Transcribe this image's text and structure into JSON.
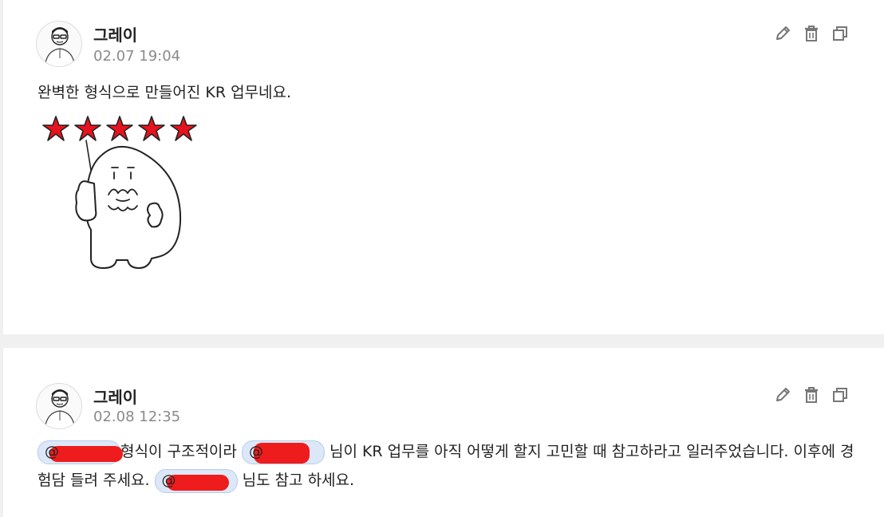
{
  "posts": [
    {
      "author": "그레이",
      "time": "02.07 19:04",
      "text": "완벽한 형식으로 만들어진 KR 업무네요.",
      "sticker": "thumbs-up-five-stars"
    },
    {
      "author": "그레이",
      "time": "02.08 12:35",
      "segments": {
        "mention_1": "@",
        "text_1": "형식이 구조적이라",
        "mention_2": "@",
        "text_2": " 님이 KR 업무를 아직 어떻게 할지 고민할 때 참고하라고 일러주었습니다. 이후에 경험담 들려 주세요.",
        "mention_3": "@",
        "text_3": " 님도 참고 하세요."
      }
    }
  ],
  "icons": {
    "edit": "pencil-icon",
    "delete": "trash-icon",
    "copy": "copy-icon"
  },
  "colors": {
    "accent": "#1a73e8",
    "mention_bg": "#dce8f8",
    "redaction": "#ee1c1c",
    "star": "#e8121e"
  }
}
